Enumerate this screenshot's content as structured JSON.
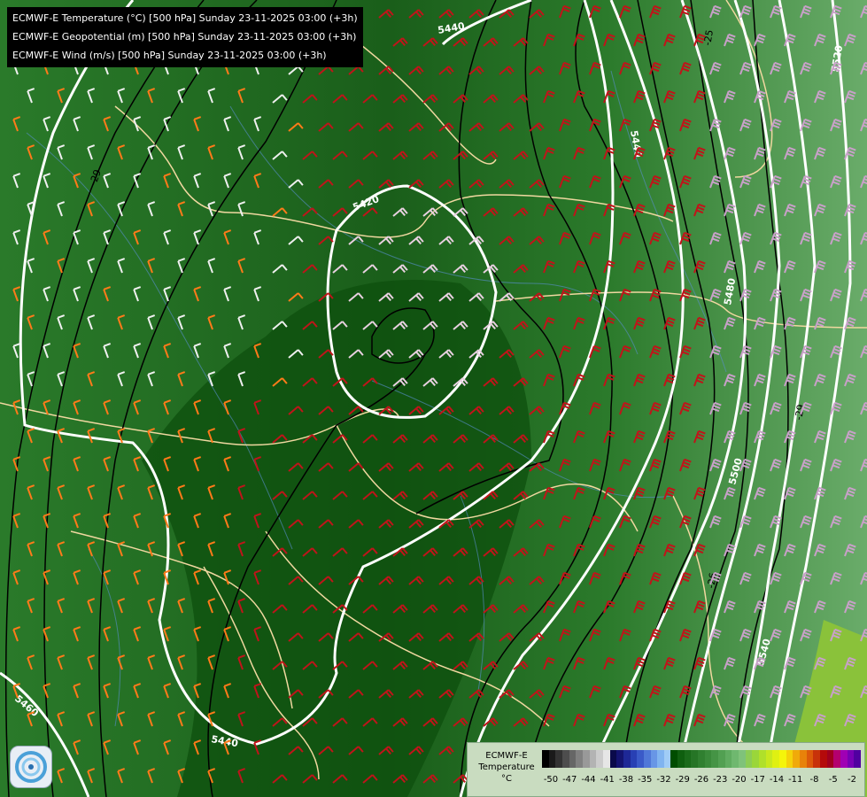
{
  "title_lines": [
    "ECMWF-E Temperature (°C) [500 hPa] Sunday 23-11-2025 03:00 (+3h)",
    "ECMWF-E Geopotential (m) [500 hPa] Sunday 23-11-2025 03:00 (+3h)",
    "ECMWF-E Wind (m/s) [500 hPa] Sunday 23-11-2025 03:00 (+3h)"
  ],
  "contour_labels": {
    "geopotential": [
      "5440",
      "5420",
      "5440",
      "5460",
      "5480",
      "5500",
      "5520",
      "5540",
      "5440",
      "5460"
    ],
    "temperature": [
      "-25",
      "-29",
      "-26",
      "-29"
    ]
  },
  "legend": {
    "title_line1": "ECMWF-E",
    "title_line2": "Temperature",
    "unit": "°C",
    "ticks": [
      "-50",
      "-47",
      "-44",
      "-41",
      "-38",
      "-35",
      "-32",
      "-29",
      "-26",
      "-23",
      "-20",
      "-17",
      "-14",
      "-11",
      "-8",
      "-5",
      "-2"
    ],
    "colors": [
      "#000000",
      "#1a1a1a",
      "#333333",
      "#4d4d4d",
      "#666666",
      "#808080",
      "#999999",
      "#b3b3b3",
      "#cccccc",
      "#e6e6e6",
      "#0a0a4a",
      "#141470",
      "#1e2896",
      "#2840b4",
      "#3a5ac8",
      "#5078d8",
      "#6896e6",
      "#80b4f0",
      "#a0ccf6",
      "#004d00",
      "#0f5f0f",
      "#1a6b1a",
      "#267526",
      "#308030",
      "#3a8a3a",
      "#459445",
      "#52a052",
      "#60ac60",
      "#6fb86f",
      "#7fc27a",
      "#8ccc55",
      "#9ad63a",
      "#b0e02a",
      "#c8e81e",
      "#dff012",
      "#f5f50a",
      "#f5d20a",
      "#f0aa0a",
      "#e8820a",
      "#dc5a0a",
      "#c8320a",
      "#b40a0a",
      "#a0001e",
      "#b4006e",
      "#a000b4",
      "#7800b4",
      "#5000a0"
    ]
  },
  "colors": {
    "background_main": "#1f6b1f",
    "background_east": "#3f8f3f",
    "geopotential_lines": "#ffffff",
    "temperature_lines": "#000000",
    "borders": "#f0d8a0",
    "rivers": "#5a8fd0"
  }
}
